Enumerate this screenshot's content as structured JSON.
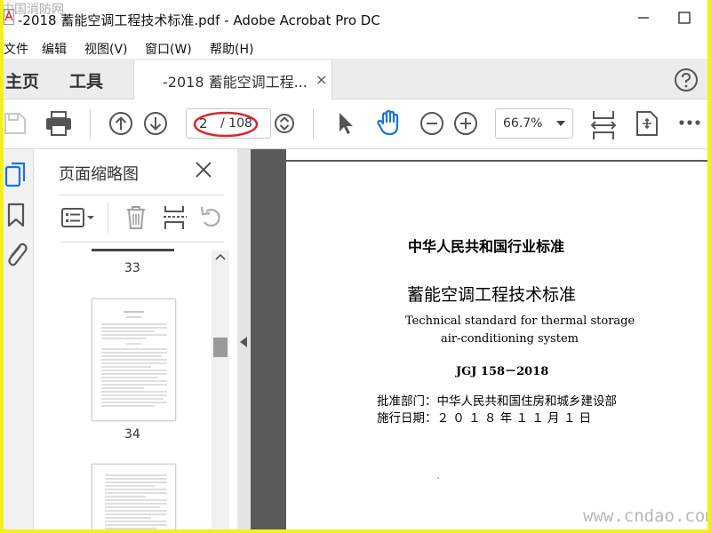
{
  "window": {
    "title": "-2018 蓄能空调工程技术标准.pdf - Adobe Acrobat Pro DC",
    "watermark_top": "中国消防网"
  },
  "menu": [
    "文件",
    "编辑",
    "视图(V)",
    "窗口(W)",
    "帮助(H)"
  ],
  "tabs": {
    "home": "主页",
    "tools": "工具",
    "document": "-2018 蓄能空调工程...",
    "close_glyph": "×"
  },
  "toolbar": {
    "page_current": "2",
    "page_total": "/ 108",
    "zoom": "66.7%"
  },
  "thumbnail_panel": {
    "title": "页面缩略图",
    "pages": [
      {
        "label": "33"
      },
      {
        "label": "34"
      }
    ]
  },
  "document": {
    "industry_standard": "中华人民共和国行业标准",
    "title_cn": "蓄能空调工程技术标准",
    "title_en_line1": "Technical standard for thermal storage",
    "title_en_line2": "air-conditioning system",
    "code": "JGJ 158－2018",
    "approval_label": "批准部门：中华人民共和国住房和城乡建设部",
    "effective_label": "施行日期：２ ０ １ ８ 年  １ １ 月  １ 日"
  },
  "watermark_bottom": "www.cndao.com",
  "colors": {
    "accent_blue": "#1473e6",
    "highlight_red": "#d9262c",
    "frame_yellow": "#f5f01a"
  }
}
